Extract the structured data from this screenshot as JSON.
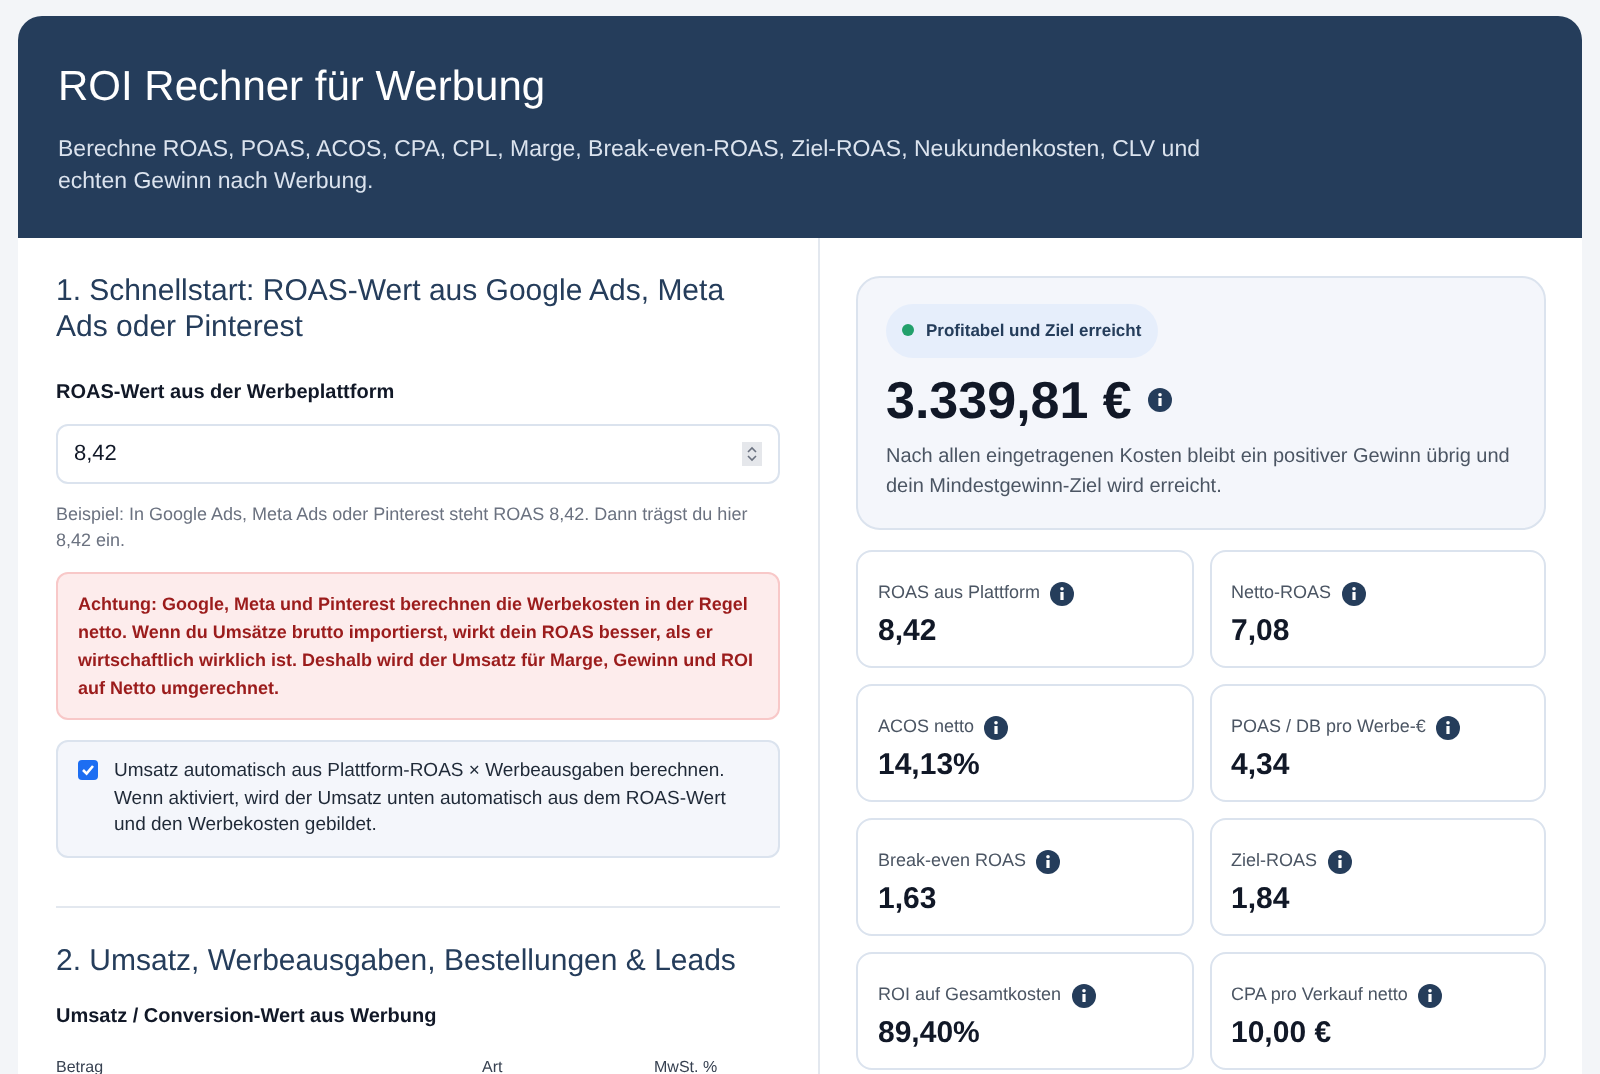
{
  "header": {
    "title": "ROI Rechner für Werbung",
    "subtitle": "Berechne ROAS, POAS, ACOS, CPA, CPL, Marge, Break-even-ROAS, Ziel-ROAS, Neukundenkosten, CLV und echten Gewinn nach Werbung."
  },
  "section1": {
    "heading": "1. Schnellstart: ROAS-Wert aus Google Ads, Meta Ads oder Pinterest",
    "field_label": "ROAS-Wert aus der Werbeplattform",
    "field_value": "8,42",
    "hint": "Beispiel: In Google Ads, Meta Ads oder Pinterest steht ROAS 8,42. Dann trägst du hier 8,42 ein.",
    "warning": "Achtung: Google, Meta und Pinterest berechnen die Werbekosten in der Regel netto. Wenn du Umsätze brutto importierst, wirkt dein ROAS besser, als er wirtschaftlich wirklich ist. Deshalb wird der Umsatz für Marge, Gewinn und ROI auf Netto umgerechnet.",
    "auto_option": {
      "label": "Umsatz automatisch aus Plattform-ROAS × Werbeausgaben berechnen. Wenn aktiviert, wird der Umsatz unten automatisch aus dem ROAS-Wert und den Werbekosten gebildet.",
      "checked": true
    }
  },
  "section2": {
    "heading": "2. Umsatz, Werbeausgaben, Bestellungen & Leads",
    "field_label": "Umsatz / Conversion-Wert aus Werbung",
    "columns": [
      "Betrag",
      "Art",
      "MwSt. %"
    ]
  },
  "summary": {
    "status": {
      "label": "Profitabel und Ziel erreicht",
      "color": "#22a06b"
    },
    "value": "3.339,81 €",
    "description": "Nach allen eingetragenen Kosten bleibt ein positiver Gewinn übrig und dein Mindestgewinn-Ziel wird erreicht."
  },
  "metrics": [
    {
      "label": "ROAS aus Plattform",
      "value": "8,42"
    },
    {
      "label": "Netto-ROAS",
      "value": "7,08"
    },
    {
      "label": "ACOS netto",
      "value": "14,13%"
    },
    {
      "label": "POAS / DB pro Werbe-€",
      "value": "4,34"
    },
    {
      "label": "Break-even ROAS",
      "value": "1,63"
    },
    {
      "label": "Ziel-ROAS",
      "value": "1,84"
    },
    {
      "label": "ROI auf Gesamtkosten",
      "value": "89,40%"
    },
    {
      "label": "CPA pro Verkauf netto",
      "value": "10,00 €"
    }
  ]
}
